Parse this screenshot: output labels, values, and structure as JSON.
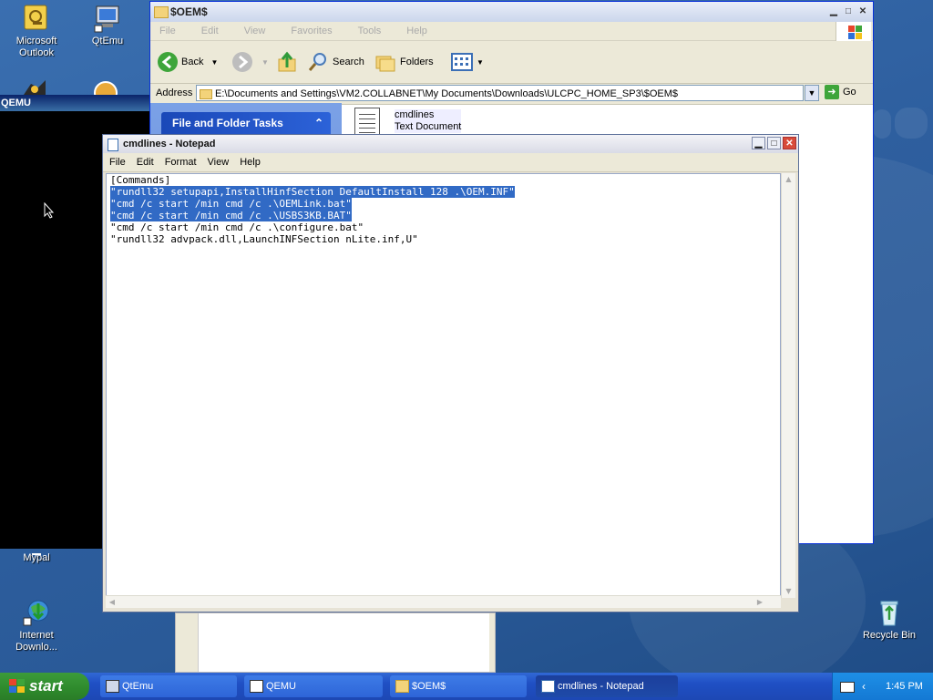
{
  "desktop": {
    "icons": {
      "outlook": "Microsoft Outlook",
      "qtemu": "QtEmu",
      "mypal": "Mypal",
      "internet": "Internet Downlo...",
      "recycle": "Recycle Bin"
    }
  },
  "qemu_window": {
    "title": "QEMU"
  },
  "explorer": {
    "title": "$OEM$",
    "menu": [
      "File",
      "Edit",
      "View",
      "Favorites",
      "Tools",
      "Help"
    ],
    "toolbar": {
      "back": "Back",
      "search": "Search",
      "folders": "Folders"
    },
    "address": {
      "label": "Address",
      "value": "E:\\Documents and Settings\\VM2.COLLABNET\\My Documents\\Downloads\\ULCPC_HOME_SP3\\$OEM$",
      "go": "Go"
    },
    "side_panel": {
      "header": "File and Folder Tasks"
    },
    "file": {
      "name": "cmdlines",
      "type": "Text Document"
    }
  },
  "notepad": {
    "title": "cmdlines - Notepad",
    "menu": [
      "File",
      "Edit",
      "Format",
      "View",
      "Help"
    ],
    "lines": [
      {
        "text": "[Commands]",
        "selected": false
      },
      {
        "text": "\"rundll32 setupapi,InstallHinfSection DefaultInstall 128 .\\OEM.INF\"",
        "selected": true
      },
      {
        "text": "\"cmd /c start /min cmd /c .\\OEMLink.bat\"",
        "selected": true
      },
      {
        "text": "\"cmd /c start /min cmd /c .\\USBS3KB.BAT\"",
        "selected": true
      },
      {
        "text": "\"cmd /c start /min cmd /c .\\configure.bat\"",
        "selected": false
      },
      {
        "text": "\"rundll32 advpack.dll,LaunchINFSection nLite.inf,U\"",
        "selected": false
      }
    ]
  },
  "taskbar": {
    "start": "start",
    "tasks": [
      "QtEmu",
      "QEMU",
      "$OEM$",
      "cmdlines - Notepad"
    ],
    "active_task": "cmdlines - Notepad",
    "clock": "1:45 PM"
  },
  "colors": {
    "selection": "#316ac5",
    "taskbar": "#1f4fc4",
    "start_button": "#2e8a2c"
  }
}
